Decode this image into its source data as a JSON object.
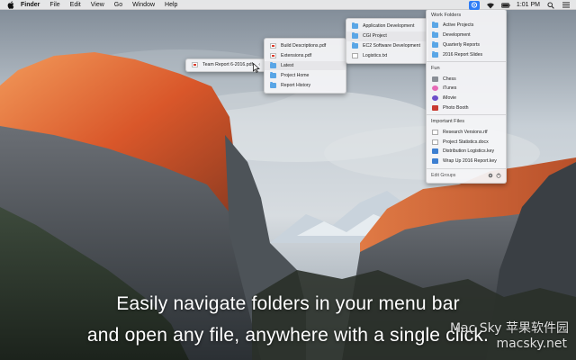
{
  "menubar": {
    "app_name": "Finder",
    "menus": [
      "File",
      "Edit",
      "View",
      "Go",
      "Window",
      "Help"
    ],
    "battery_percent": "100%",
    "clock": "1:01 PM"
  },
  "menus": {
    "level1": {
      "items": [
        {
          "label": "Team Report 6-2016.pdf",
          "icon": "pdf-icon"
        }
      ]
    },
    "level2": {
      "items": [
        {
          "label": "Build Descriptions.pdf",
          "icon": "pdf-icon"
        },
        {
          "label": "Extensions.pdf",
          "icon": "pdf-icon"
        },
        {
          "label": "Latest",
          "icon": "folder-icon"
        },
        {
          "label": "Project Home",
          "icon": "folder-icon"
        },
        {
          "label": "Report History",
          "icon": "folder-icon"
        }
      ]
    },
    "level3": {
      "items": [
        {
          "label": "Application Development",
          "icon": "folder-icon"
        },
        {
          "label": "CGI Project",
          "icon": "folder-icon"
        },
        {
          "label": "EC2 Software Development",
          "icon": "folder-icon"
        },
        {
          "label": "Logistics.txt",
          "icon": "document-icon"
        }
      ]
    },
    "main": {
      "work_folders_title": "Work Folders",
      "work_folders": [
        {
          "label": "Active Projects"
        },
        {
          "label": "Development"
        },
        {
          "label": "Quarterly Reports"
        },
        {
          "label": "2016 Report Slides"
        }
      ],
      "fun_title": "Fun",
      "fun": [
        {
          "label": "Chess",
          "icon": "chess-icon"
        },
        {
          "label": "iTunes",
          "icon": "itunes-icon"
        },
        {
          "label": "iMovie",
          "icon": "imovie-icon"
        },
        {
          "label": "Photo Booth",
          "icon": "photo-booth-icon"
        }
      ],
      "important_files_title": "Important Files",
      "important_files": [
        {
          "label": "Research Versions.rtf",
          "icon": "document-icon"
        },
        {
          "label": "Project Statistics.docx",
          "icon": "document-icon"
        },
        {
          "label": "Distribution Logistics.key",
          "icon": "keynote-icon"
        },
        {
          "label": "Wrap Up 2016 Report.key",
          "icon": "keynote-icon"
        }
      ],
      "edit_groups_label": "Edit Groups"
    }
  },
  "caption": {
    "line1": "Easily navigate folders in your menu bar",
    "line2": "and open any file, anywhere with a single click."
  },
  "watermark": {
    "line1": "Mac Sky 苹果软件园",
    "line2": "macsky.net"
  },
  "colors": {
    "menubar_bg": "#ececec",
    "accent": "#2f7df6",
    "folder": "#5aa6e6",
    "mountain_glow": "#e8602a"
  }
}
